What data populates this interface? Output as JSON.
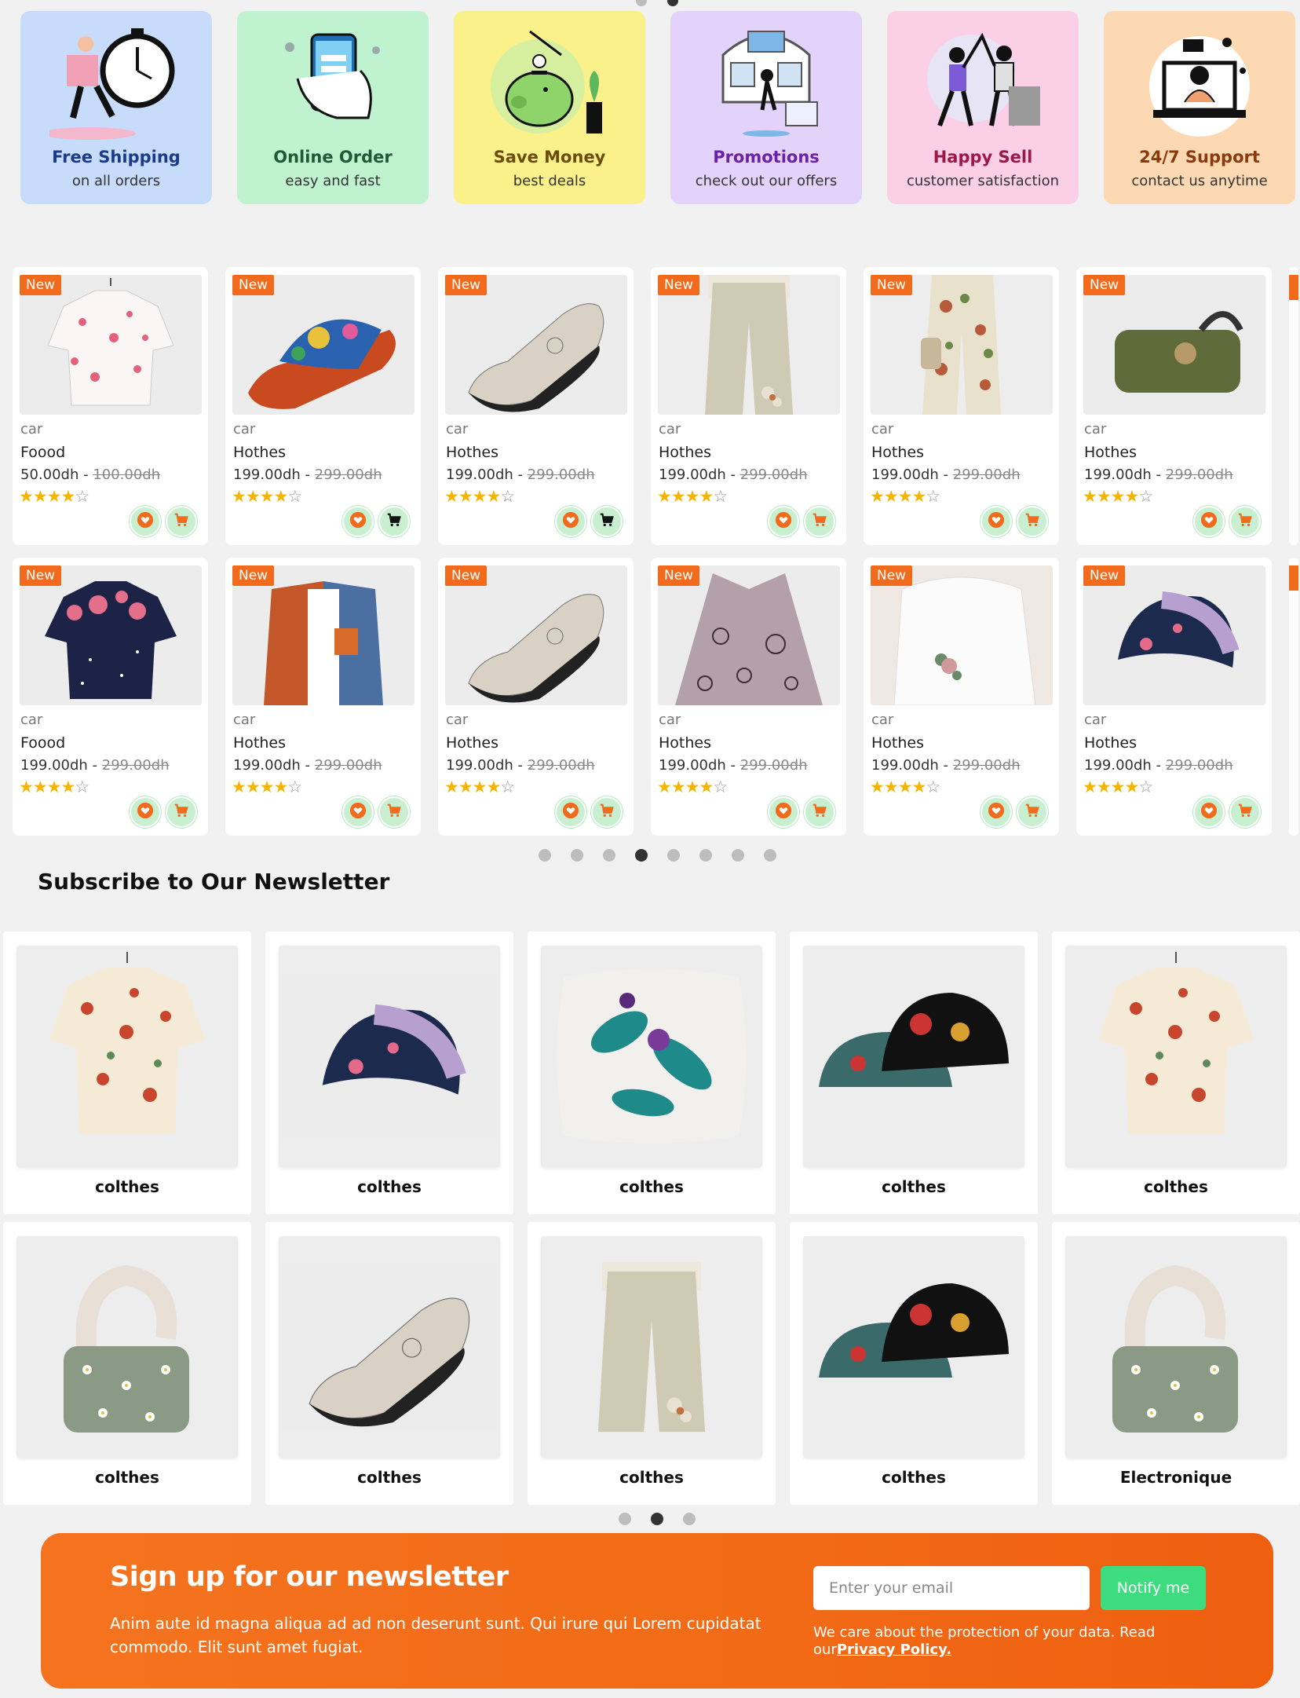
{
  "features": [
    {
      "title": "Free Shipping",
      "subtitle": "on all orders",
      "bg": "#c7dcfb",
      "color": "#1b3a8a",
      "icon": "delivery-clock-icon"
    },
    {
      "title": "Online Order",
      "subtitle": "easy and fast",
      "bg": "#bff3cf",
      "color": "#1e5a33",
      "icon": "phone-order-icon"
    },
    {
      "title": "Save Money",
      "subtitle": "best deals",
      "bg": "#fbf18a",
      "color": "#6b4c0c",
      "icon": "piggy-bank-icon"
    },
    {
      "title": "Promotions",
      "subtitle": "check out our offers",
      "bg": "#e3d3fb",
      "color": "#6b21a8",
      "icon": "promotion-icon"
    },
    {
      "title": "Happy Sell",
      "subtitle": "customer satisfaction",
      "bg": "#fbd0e6",
      "color": "#9d1747",
      "icon": "high-five-icon"
    },
    {
      "title": "24/7 Support",
      "subtitle": "contact us anytime",
      "bg": "#fcd9b3",
      "color": "#8a3a0c",
      "icon": "support-laptop-icon"
    }
  ],
  "product_badge": "New",
  "products": [
    [
      {
        "category": "car",
        "name": "Foood",
        "price": "50.00dh",
        "old_price": "100.00dh",
        "rating": 4,
        "image": "floral-shirt",
        "cart_dark": false
      },
      {
        "category": "car",
        "name": "Hothes",
        "price": "199.00dh",
        "old_price": "299.00dh",
        "rating": 4,
        "image": "sandal",
        "cart_dark": true
      },
      {
        "category": "car",
        "name": "Hothes",
        "price": "199.00dh",
        "old_price": "299.00dh",
        "rating": 4,
        "image": "shoe",
        "cart_dark": true
      },
      {
        "category": "car",
        "name": "Hothes",
        "price": "199.00dh",
        "old_price": "299.00dh",
        "rating": 4,
        "image": "pants",
        "cart_dark": false
      },
      {
        "category": "car",
        "name": "Hothes",
        "price": "199.00dh",
        "old_price": "299.00dh",
        "rating": 4,
        "image": "floral-pants",
        "cart_dark": false
      },
      {
        "category": "car",
        "name": "Hothes",
        "price": "199.00dh",
        "old_price": "299.00dh",
        "rating": 4,
        "image": "bag",
        "cart_dark": false
      }
    ],
    [
      {
        "category": "car",
        "name": "Foood",
        "price": "199.00dh",
        "old_price": "299.00dh",
        "rating": 4,
        "image": "navy-shirt",
        "cart_dark": false
      },
      {
        "category": "car",
        "name": "Hothes",
        "price": "199.00dh",
        "old_price": "299.00dh",
        "rating": 4,
        "image": "jacket",
        "cart_dark": false
      },
      {
        "category": "car",
        "name": "Hothes",
        "price": "199.00dh",
        "old_price": "299.00dh",
        "rating": 4,
        "image": "shoe",
        "cart_dark": false
      },
      {
        "category": "car",
        "name": "Hothes",
        "price": "199.00dh",
        "old_price": "299.00dh",
        "rating": 4,
        "image": "blouse",
        "cart_dark": false
      },
      {
        "category": "car",
        "name": "Hothes",
        "price": "199.00dh",
        "old_price": "299.00dh",
        "rating": 4,
        "image": "white-top",
        "cart_dark": false
      },
      {
        "category": "car",
        "name": "Hothes",
        "price": "199.00dh",
        "old_price": "299.00dh",
        "rating": 4,
        "image": "beanie",
        "cart_dark": false
      }
    ]
  ],
  "product_dots": {
    "count": 8,
    "active": 3
  },
  "section_title": "Subscribe to Our Newsletter",
  "categories": [
    [
      {
        "name": "colthes",
        "image": "mushroom-shirt"
      },
      {
        "name": "colthes",
        "image": "beanie"
      },
      {
        "name": "colthes",
        "image": "pillow"
      },
      {
        "name": "colthes",
        "image": "bucket-hats"
      },
      {
        "name": "colthes",
        "image": "mushroom-shirt"
      }
    ],
    [
      {
        "name": "colthes",
        "image": "daisy-bag"
      },
      {
        "name": "colthes",
        "image": "shoe"
      },
      {
        "name": "colthes",
        "image": "pants"
      },
      {
        "name": "colthes",
        "image": "bucket-hats"
      },
      {
        "name": "Electronique",
        "image": "daisy-bag"
      }
    ]
  ],
  "category_dots": {
    "count": 3,
    "active": 1
  },
  "newsletter": {
    "title": "Sign up for our newsletter",
    "description": "Anim aute id magna aliqua ad ad non deserunt sunt. Qui irure qui Lorem cupidatat commodo. Elit sunt amet fugiat.",
    "email_placeholder": "Enter your email",
    "button": "Notify me",
    "note_prefix": "We care about the protection of your data. Read our",
    "privacy_link": "Privacy Policy."
  },
  "colors": {
    "accent": "#f26a1b",
    "green": "#3ddc7f",
    "star": "#f5b400"
  }
}
